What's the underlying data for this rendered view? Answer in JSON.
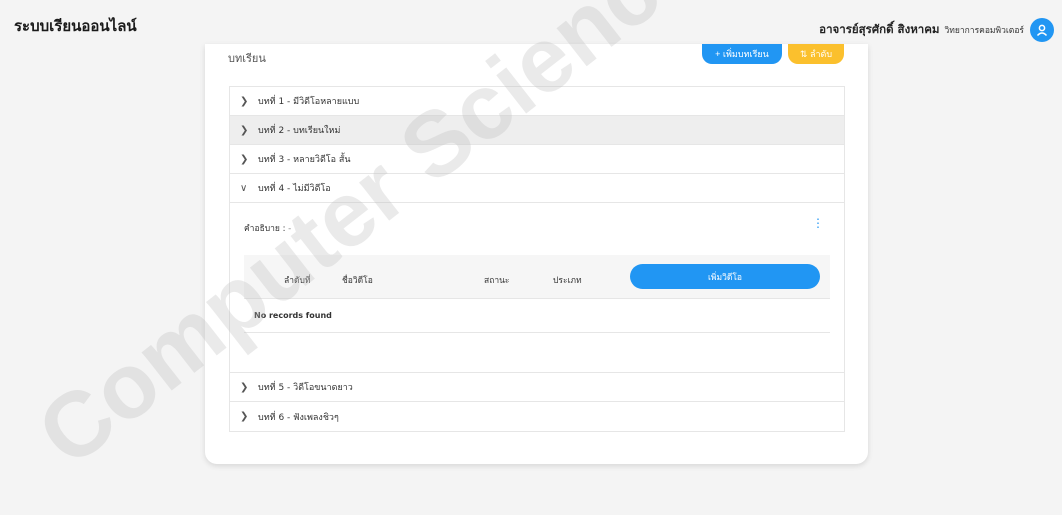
{
  "header": {
    "brand": "ระบบเรียนออนไลน์",
    "user_name": "อาจารย์สุรศักดิ์ สิงหาคม",
    "user_dept": "วิทยาการคอมพิวเตอร์",
    "avatar_icon": "person-icon"
  },
  "card": {
    "title": "บทเรียน",
    "add_lesson_label": "+ เพิ่มบทเรียน",
    "sort_label": "⇅ ลำดับ"
  },
  "lessons": [
    {
      "label": "บทที่ 1 - มีวิดีโอหลายแบบ",
      "expanded": false
    },
    {
      "label": "บทที่ 2 - บทเรียนใหม่",
      "expanded": false
    },
    {
      "label": "บทที่ 3 - หลายวิดีโอ สั้น",
      "expanded": false
    },
    {
      "label": "บทที่ 4 - ไม่มีวิดีโอ",
      "expanded": true
    },
    {
      "label": "บทที่ 5 - วิดีโอขนาดยาว",
      "expanded": false
    },
    {
      "label": "บทที่ 6 - ฟังเพลงชิวๆ",
      "expanded": false
    }
  ],
  "lesson_detail": {
    "desc_label": "คำอธิบาย :",
    "desc_value": " -",
    "columns": [
      "ลำดับที่",
      "ชื่อวิดีโอ",
      "สถานะ",
      "ประเภท"
    ],
    "add_video_label": "เพิ่มวิดีโอ",
    "empty_text": "No records found"
  },
  "watermark": "Computer Science, Mahasarakham Informatics",
  "colors": {
    "primary": "#2196f3",
    "warning": "#fbc02d"
  }
}
